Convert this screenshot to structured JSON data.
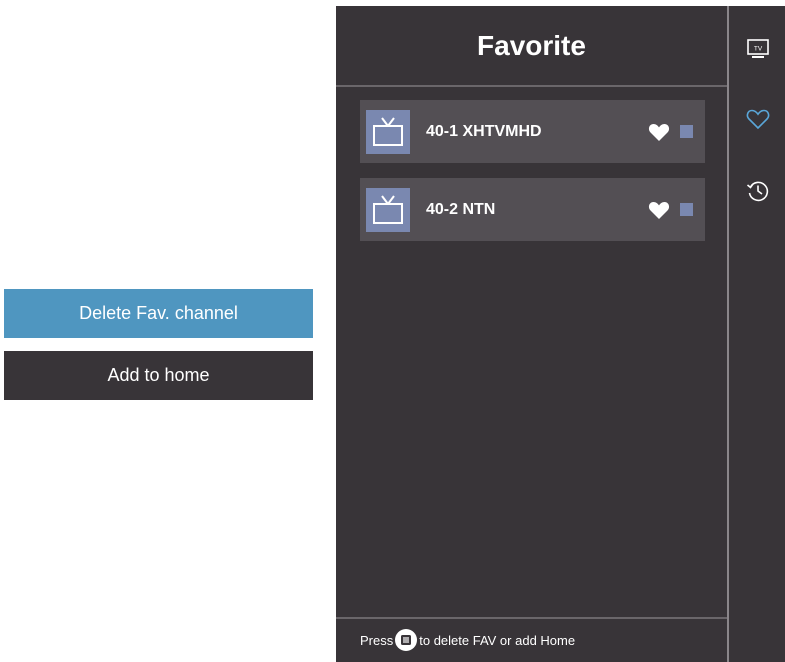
{
  "context_menu": {
    "items": [
      {
        "label": "Delete Fav. channel",
        "selected": true
      },
      {
        "label": "Add to home",
        "selected": false
      }
    ]
  },
  "panel": {
    "title": "Favorite",
    "channels": [
      {
        "name": "40-1 XHTVMHD",
        "favorite": true
      },
      {
        "name": "40-2 NTN",
        "favorite": true
      }
    ],
    "footer": {
      "prefix": "Press",
      "suffix": "to delete FAV or add Home",
      "key_icon": "menu-key-icon"
    }
  },
  "rail": {
    "items": [
      {
        "icon": "tv-icon",
        "label": "TV",
        "active": false
      },
      {
        "icon": "heart-icon",
        "active": true
      },
      {
        "icon": "history-icon",
        "active": false
      }
    ]
  },
  "colors": {
    "panel_bg": "#383438",
    "row_bg": "#534f54",
    "selected_bg": "#4f96c0",
    "thumb": "#7a88b0",
    "active_icon": "#5aa6d8"
  }
}
